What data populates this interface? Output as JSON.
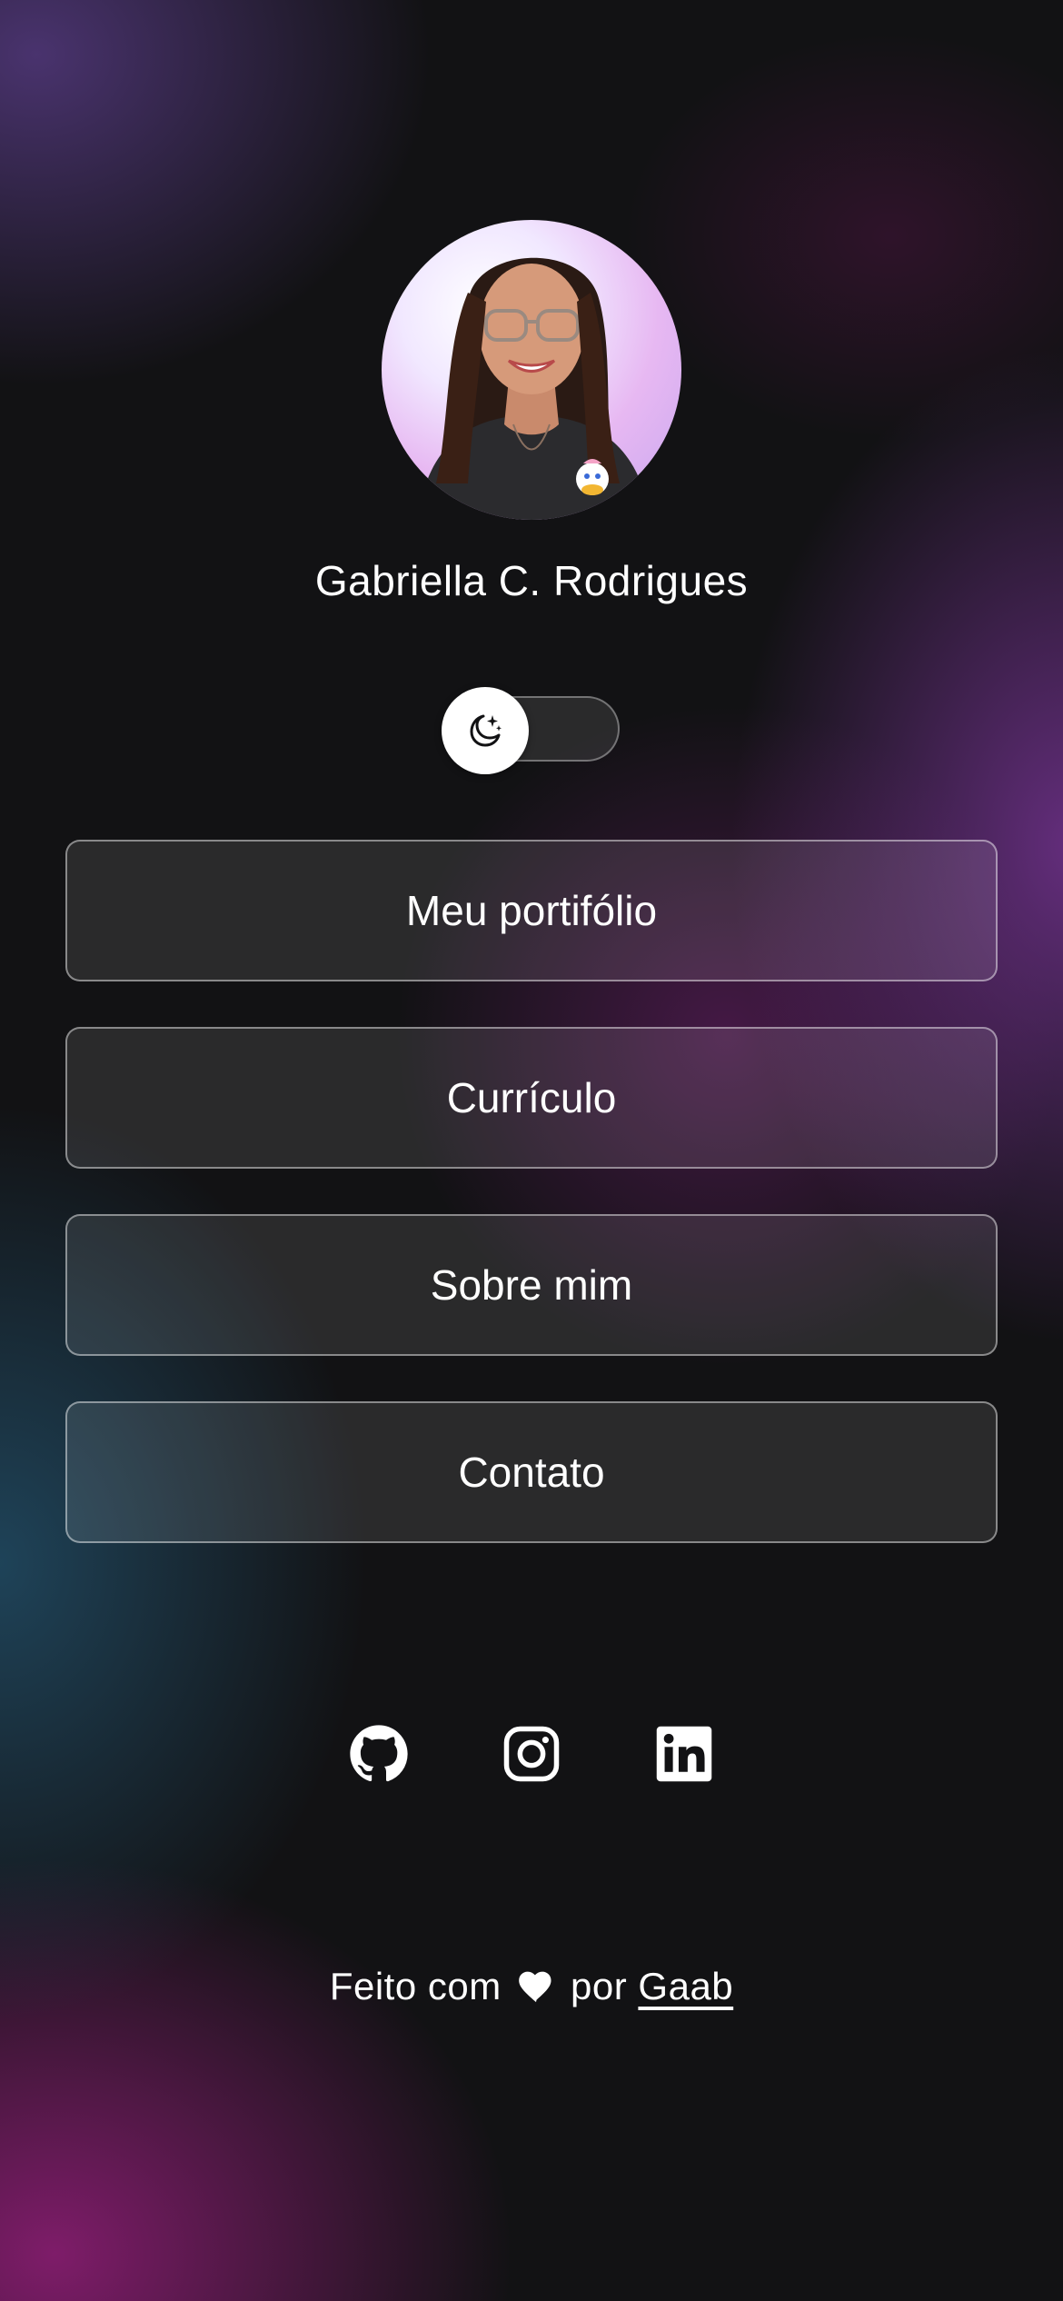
{
  "profile": {
    "name": "Gabriella C. Rodrigues",
    "avatar_icon": "profile-photo"
  },
  "theme_toggle": {
    "mode": "dark",
    "icon": "moon-stars-icon"
  },
  "links": [
    {
      "label": "Meu portifólio"
    },
    {
      "label": "Currículo"
    },
    {
      "label": "Sobre mim"
    },
    {
      "label": "Contato"
    }
  ],
  "socials": [
    {
      "icon": "github-icon"
    },
    {
      "icon": "instagram-icon"
    },
    {
      "icon": "linkedin-icon"
    }
  ],
  "footer": {
    "prefix": "Feito com",
    "middle": "por",
    "author": "Gaab"
  },
  "colors": {
    "background": "#121214",
    "accent_purple": "#7a3496",
    "accent_teal": "#245876",
    "accent_magenta": "#911e78",
    "text": "#ffffff"
  }
}
